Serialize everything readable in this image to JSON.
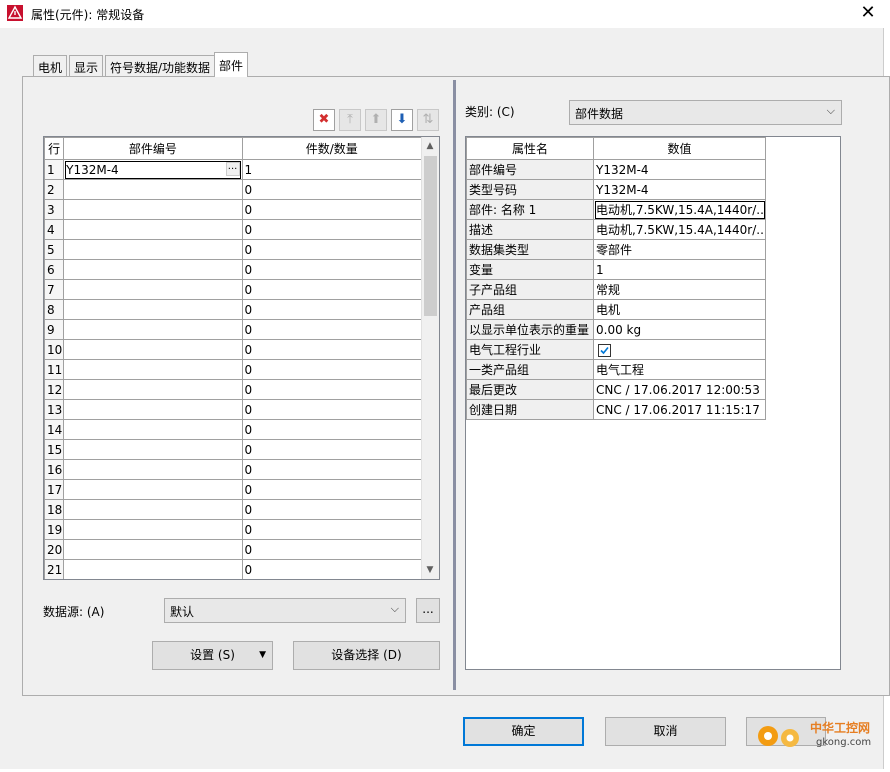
{
  "window": {
    "title": "属性(元件): 常规设备",
    "close": "✕"
  },
  "tabs": [
    {
      "label": "电机",
      "active": false
    },
    {
      "label": "显示",
      "active": false
    },
    {
      "label": "符号数据/功能数据",
      "active": false
    },
    {
      "label": "部件",
      "active": true
    }
  ],
  "toolbar": {
    "delete": "✖",
    "move_top": "⤒",
    "move_up": "⬆",
    "move_down": "⬇",
    "swap": "⇅"
  },
  "parts_table": {
    "headers": {
      "row": "行",
      "part_number": "部件编号",
      "quantity": "件数/数量"
    },
    "rows": [
      {
        "n": "1",
        "part": "Y132M-4",
        "qty": "1"
      },
      {
        "n": "2",
        "part": "",
        "qty": "0"
      },
      {
        "n": "3",
        "part": "",
        "qty": "0"
      },
      {
        "n": "4",
        "part": "",
        "qty": "0"
      },
      {
        "n": "5",
        "part": "",
        "qty": "0"
      },
      {
        "n": "6",
        "part": "",
        "qty": "0"
      },
      {
        "n": "7",
        "part": "",
        "qty": "0"
      },
      {
        "n": "8",
        "part": "",
        "qty": "0"
      },
      {
        "n": "9",
        "part": "",
        "qty": "0"
      },
      {
        "n": "10",
        "part": "",
        "qty": "0"
      },
      {
        "n": "11",
        "part": "",
        "qty": "0"
      },
      {
        "n": "12",
        "part": "",
        "qty": "0"
      },
      {
        "n": "13",
        "part": "",
        "qty": "0"
      },
      {
        "n": "14",
        "part": "",
        "qty": "0"
      },
      {
        "n": "15",
        "part": "",
        "qty": "0"
      },
      {
        "n": "16",
        "part": "",
        "qty": "0"
      },
      {
        "n": "17",
        "part": "",
        "qty": "0"
      },
      {
        "n": "18",
        "part": "",
        "qty": "0"
      },
      {
        "n": "19",
        "part": "",
        "qty": "0"
      },
      {
        "n": "20",
        "part": "",
        "qty": "0"
      },
      {
        "n": "21",
        "part": "",
        "qty": "0"
      }
    ],
    "ellipsis": "..."
  },
  "datasource": {
    "label": "数据源: (A)",
    "value": "默认",
    "browse": "..."
  },
  "buttons": {
    "settings": "设置 (S)",
    "device_select": "设备选择 (D)",
    "ok": "确定",
    "cancel": "取消"
  },
  "category": {
    "label": "类别: (C)",
    "value": "部件数据"
  },
  "props_table": {
    "headers": {
      "name": "属性名",
      "value": "数值"
    },
    "rows": [
      {
        "k": "部件编号",
        "v": "Y132M-4"
      },
      {
        "k": "类型号码",
        "v": "Y132M-4"
      },
      {
        "k": "部件: 名称 1",
        "v": "电动机,7.5KW,15.4A,1440r/..."
      },
      {
        "k": "描述",
        "v": "电动机,7.5KW,15.4A,1440r/..."
      },
      {
        "k": "数据集类型",
        "v": "零部件"
      },
      {
        "k": "变量",
        "v": "1"
      },
      {
        "k": "子产品组",
        "v": "常规"
      },
      {
        "k": "产品组",
        "v": "电机"
      },
      {
        "k": "以显示单位表示的重量",
        "v": "0.00 kg"
      },
      {
        "k": "电气工程行业",
        "v": "",
        "checked": true
      },
      {
        "k": "一类产品组",
        "v": "电气工程"
      },
      {
        "k": "最后更改",
        "v": "CNC / 17.06.2017 12:00:53"
      },
      {
        "k": "创建日期",
        "v": "CNC / 17.06.2017 11:15:17"
      }
    ]
  },
  "watermark": {
    "cn": "中华工控网",
    "url": "gkong.com"
  },
  "colors": {
    "accent": "#0078d7",
    "delete_red": "#d32f2f",
    "move_blue": "#1e5fb4",
    "watermark_orange": "#f39c12"
  }
}
